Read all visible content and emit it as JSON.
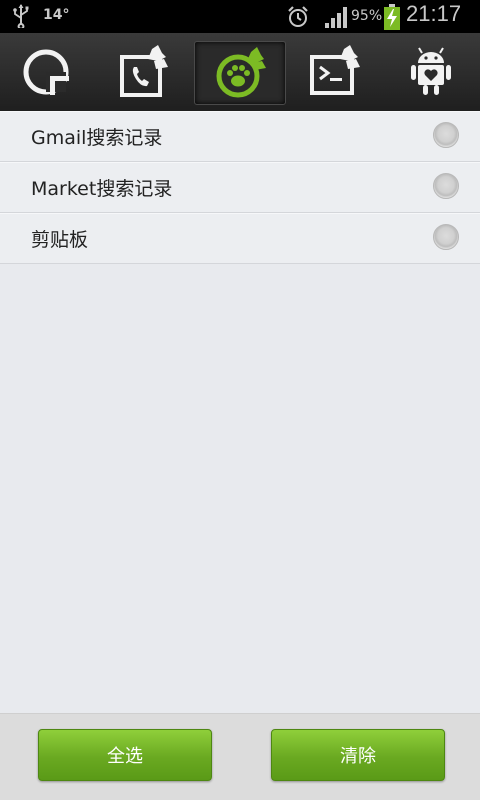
{
  "status_bar": {
    "temperature": "14°",
    "battery_percent": "95%",
    "time": "21:17",
    "icons": [
      "usb-icon",
      "alarm-icon",
      "signal-icon",
      "battery-charging-icon"
    ]
  },
  "toolbar": {
    "tabs": [
      {
        "icon": "pie-chart-icon",
        "active": false
      },
      {
        "icon": "call-log-clean-icon",
        "active": false
      },
      {
        "icon": "paw-clean-icon",
        "active": true
      },
      {
        "icon": "terminal-clean-icon",
        "active": false
      },
      {
        "icon": "android-heart-icon",
        "active": false
      }
    ],
    "accent_color": "#7cbb24"
  },
  "list": {
    "items": [
      {
        "label": "Gmail搜索记录",
        "selected": false
      },
      {
        "label": "Market搜索记录",
        "selected": false
      },
      {
        "label": "剪贴板",
        "selected": false
      }
    ]
  },
  "bottom_bar": {
    "select_all_label": "全选",
    "clear_label": "清除",
    "button_color": "#6aa921"
  }
}
